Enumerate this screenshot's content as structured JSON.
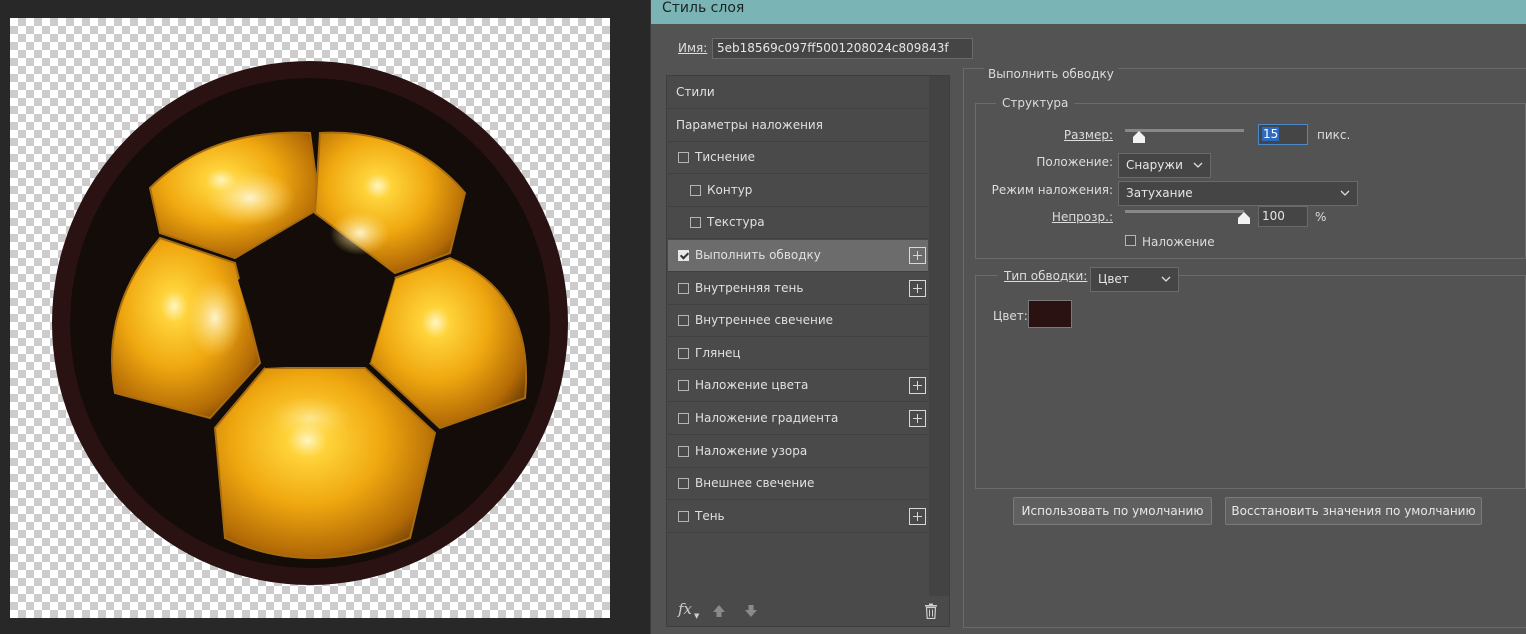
{
  "dialog": {
    "title": "Стиль слоя",
    "name_label": "Имя:",
    "name_value": "5eb18569c097ff5001208024c809843f"
  },
  "styles_list": [
    {
      "label": "Стили",
      "checkbox": false,
      "checked": false,
      "plus": false,
      "indent": 0,
      "selected": false
    },
    {
      "label": "Параметры наложения",
      "checkbox": false,
      "checked": false,
      "plus": false,
      "indent": 0,
      "selected": false
    },
    {
      "label": "Тиснение",
      "checkbox": true,
      "checked": false,
      "plus": false,
      "indent": 0,
      "selected": false
    },
    {
      "label": "Контур",
      "checkbox": true,
      "checked": false,
      "plus": false,
      "indent": 1,
      "selected": false
    },
    {
      "label": "Текстура",
      "checkbox": true,
      "checked": false,
      "plus": false,
      "indent": 1,
      "selected": false
    },
    {
      "label": "Выполнить обводку",
      "checkbox": true,
      "checked": true,
      "plus": true,
      "indent": 0,
      "selected": true
    },
    {
      "label": "Внутренняя тень",
      "checkbox": true,
      "checked": false,
      "plus": true,
      "indent": 0,
      "selected": false
    },
    {
      "label": "Внутреннее свечение",
      "checkbox": true,
      "checked": false,
      "plus": false,
      "indent": 0,
      "selected": false
    },
    {
      "label": "Глянец",
      "checkbox": true,
      "checked": false,
      "plus": false,
      "indent": 0,
      "selected": false
    },
    {
      "label": "Наложение цвета",
      "checkbox": true,
      "checked": false,
      "plus": true,
      "indent": 0,
      "selected": false
    },
    {
      "label": "Наложение градиента",
      "checkbox": true,
      "checked": false,
      "plus": true,
      "indent": 0,
      "selected": false
    },
    {
      "label": "Наложение узора",
      "checkbox": true,
      "checked": false,
      "plus": false,
      "indent": 0,
      "selected": false
    },
    {
      "label": "Внешнее свечение",
      "checkbox": true,
      "checked": false,
      "plus": false,
      "indent": 0,
      "selected": false
    },
    {
      "label": "Тень",
      "checkbox": true,
      "checked": false,
      "plus": true,
      "indent": 0,
      "selected": false
    }
  ],
  "list_toolbar": {
    "fx_label": "fx",
    "icons": [
      "fx-menu-icon",
      "move-up-icon",
      "move-down-icon",
      "trash-icon"
    ]
  },
  "stroke": {
    "section_title": "Выполнить обводку",
    "structure_title": "Структура",
    "size_label": "Размер:",
    "size_value": "15",
    "size_unit": "пикс.",
    "size_slider_fraction": 0.12,
    "position_label": "Положение:",
    "position_value": "Снаружи",
    "blend_label": "Режим наложения:",
    "blend_value": "Затухание",
    "opacity_label": "Непрозр.:",
    "opacity_value": "100",
    "opacity_unit": "%",
    "opacity_slider_fraction": 1.0,
    "overprint_label": "Наложение",
    "overprint_checked": false,
    "fill_type_label": "Тип обводки:",
    "fill_type_value": "Цвет",
    "color_label": "Цвет:",
    "color_value": "#2a1212"
  },
  "buttons": {
    "make_default": "Использовать по умолчанию",
    "reset_default": "Восстановить значения по умолчанию"
  },
  "colors": {
    "titlebar": "#7ab4b4",
    "dialog_bg": "#535353",
    "ball_gold": "#f0a810",
    "ball_patch": "#140c08",
    "stroke_ring": "#2a1212"
  }
}
